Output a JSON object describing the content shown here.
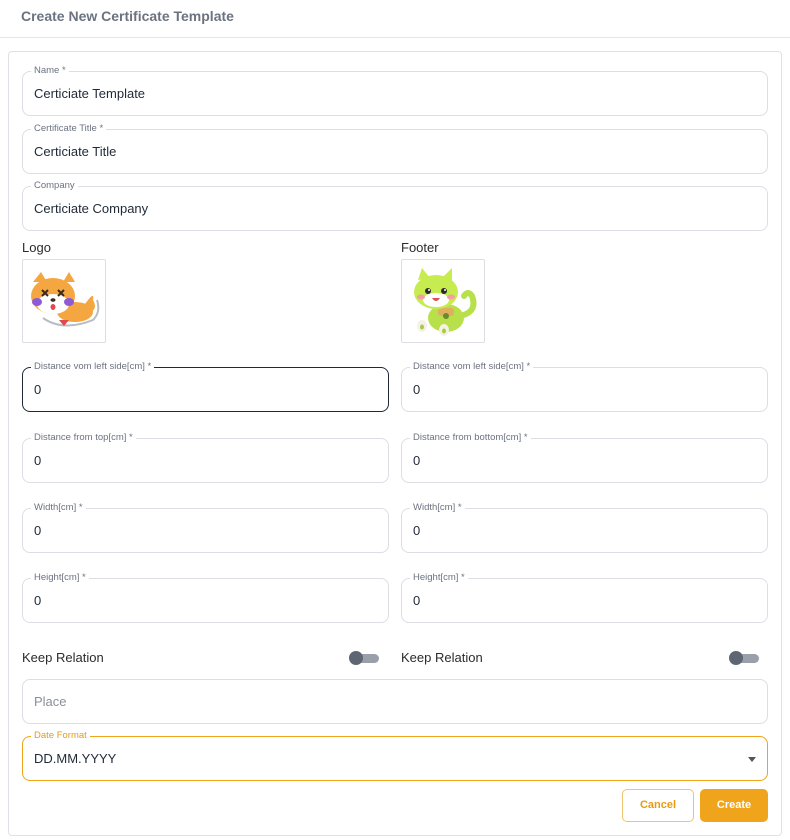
{
  "header": {
    "title": "Create New Certificate Template"
  },
  "form": {
    "name": {
      "label": "Name *",
      "value": "Certiciate Template"
    },
    "certificate_title": {
      "label": "Certificate Title *",
      "value": "Certiciate Title"
    },
    "company": {
      "label": "Company",
      "value": "Certiciate Company"
    },
    "logo": {
      "heading": "Logo",
      "image": "shiba-dog-mascot",
      "distance_left": {
        "label": "Distance vom left side[cm] *",
        "value": "0"
      },
      "distance_top": {
        "label": "Distance from top[cm] *",
        "value": "0"
      },
      "width": {
        "label": "Width[cm] *",
        "value": "0"
      },
      "height": {
        "label": "Height[cm] *",
        "value": "0"
      },
      "keep_relation": {
        "label": "Keep Relation",
        "on": false
      }
    },
    "footer": {
      "heading": "Footer",
      "image": "green-cat-mascot",
      "distance_left": {
        "label": "Distance vom left side[cm] *",
        "value": "0"
      },
      "distance_bottom": {
        "label": "Distance from bottom[cm] *",
        "value": "0"
      },
      "width": {
        "label": "Width[cm] *",
        "value": "0"
      },
      "height": {
        "label": "Height[cm] *",
        "value": "0"
      },
      "keep_relation": {
        "label": "Keep Relation",
        "on": false
      }
    },
    "place": {
      "placeholder": "Place",
      "value": ""
    },
    "date_format": {
      "label": "Date Format",
      "value": "DD.MM.YYYY"
    }
  },
  "actions": {
    "cancel_label": "Cancel",
    "create_label": "Create"
  },
  "colors": {
    "accent": "#f0a41b",
    "border": "#dcdee3",
    "toggle_off": "#5f6673"
  }
}
